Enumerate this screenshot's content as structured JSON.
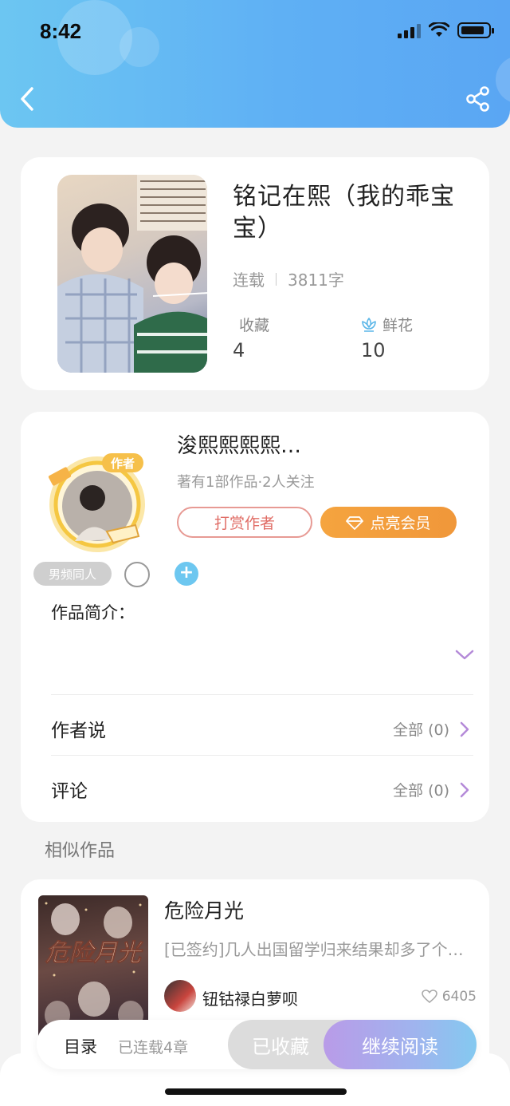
{
  "status_bar": {
    "time": "8:42"
  },
  "header": {
    "back_icon": "chevron-left-icon",
    "share_icon": "share-icon"
  },
  "book": {
    "title": "铭记在熙（我的乖宝宝）",
    "status": "连载",
    "word_count": "3811字",
    "collect_label": "收藏",
    "collect_count": "4",
    "flower_label": "鲜花",
    "flower_count": "10"
  },
  "author": {
    "name": "浚熙熙熙熙…",
    "badge": "作者",
    "info": "著有1部作品·2人关注",
    "tip_button": "打赏作者",
    "vip_button": "点亮会员",
    "tag": "男频同人",
    "add_tag": "+"
  },
  "intro": {
    "label": "作品简介："
  },
  "rows": {
    "author_says": {
      "label": "作者说",
      "value": "全部 (0)"
    },
    "comments": {
      "label": "评论",
      "value": "全部 (0)"
    }
  },
  "similar": {
    "section_title": "相似作品",
    "items": [
      {
        "title": "危险月光",
        "cover_text": "危险月光",
        "desc": "[已签约]几人出国留学归来结果却多了个…",
        "author": "钮钴禄白萝呗",
        "likes": "6405"
      }
    ]
  },
  "bottom_bar": {
    "toc": "目录",
    "chapters": "已连载4章",
    "collected": "已收藏",
    "continue_reading": "继续阅读"
  },
  "colors": {
    "header_blue": "#5fb0f4",
    "tip_red": "#e06d66",
    "vip_orange": "#f5a43f",
    "accent_purple": "#b99be8"
  }
}
